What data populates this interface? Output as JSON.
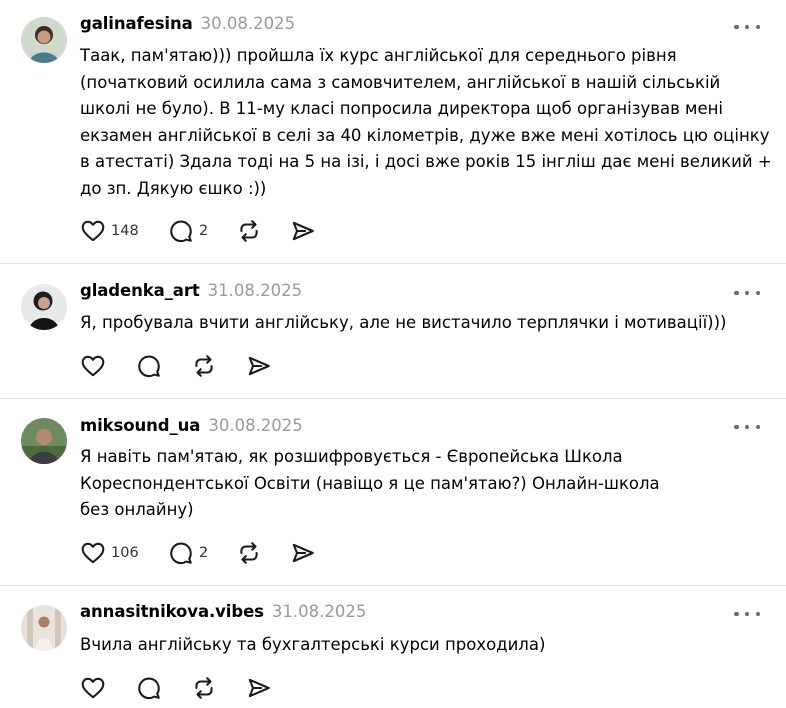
{
  "comments": [
    {
      "username": "galinafesina",
      "date": "30.08.2025",
      "text": "Таак, пам'ятаю))) пройшла їх курс англійської для середнього рівня\n(початковий осилила сама з самовчителем, англійської в нашій сільській\nшколі не було). В 11-му класі попросила директора щоб організував мені\nекзамен англійської в селі за 40 кілометрів, дуже вже мені хотілось цю оцінку\nв атестаті) Здала тоді на 5 на ізі, і досі вже років 15 інгліш дає мені великий +\nдо зп. Дякую єшко :))",
      "likes": "148",
      "replies": "2"
    },
    {
      "username": "gladenka_art",
      "date": "31.08.2025",
      "text": "Я, пробувала вчити англійську, але не вистачило терплячки і мотивації)))",
      "likes": "",
      "replies": ""
    },
    {
      "username": "miksound_ua",
      "date": "30.08.2025",
      "text": "Я навіть пам'ятаю, як розшифровується - Європейська Школа\nКореспондентської Освіти (навіщо я це пам'ятаю?) Онлайн-школа\nбез онлайну)",
      "likes": "106",
      "replies": "2"
    },
    {
      "username": "annasitnikova.vibes",
      "date": "31.08.2025",
      "text": "Вчила англійську та бухгалтерські курси проходила)",
      "likes": "",
      "replies": ""
    }
  ],
  "icons": {
    "like": "heart-icon",
    "reply": "comment-bubble-icon",
    "repost": "repost-icon",
    "share": "send-icon",
    "more": "more-options-icon"
  }
}
